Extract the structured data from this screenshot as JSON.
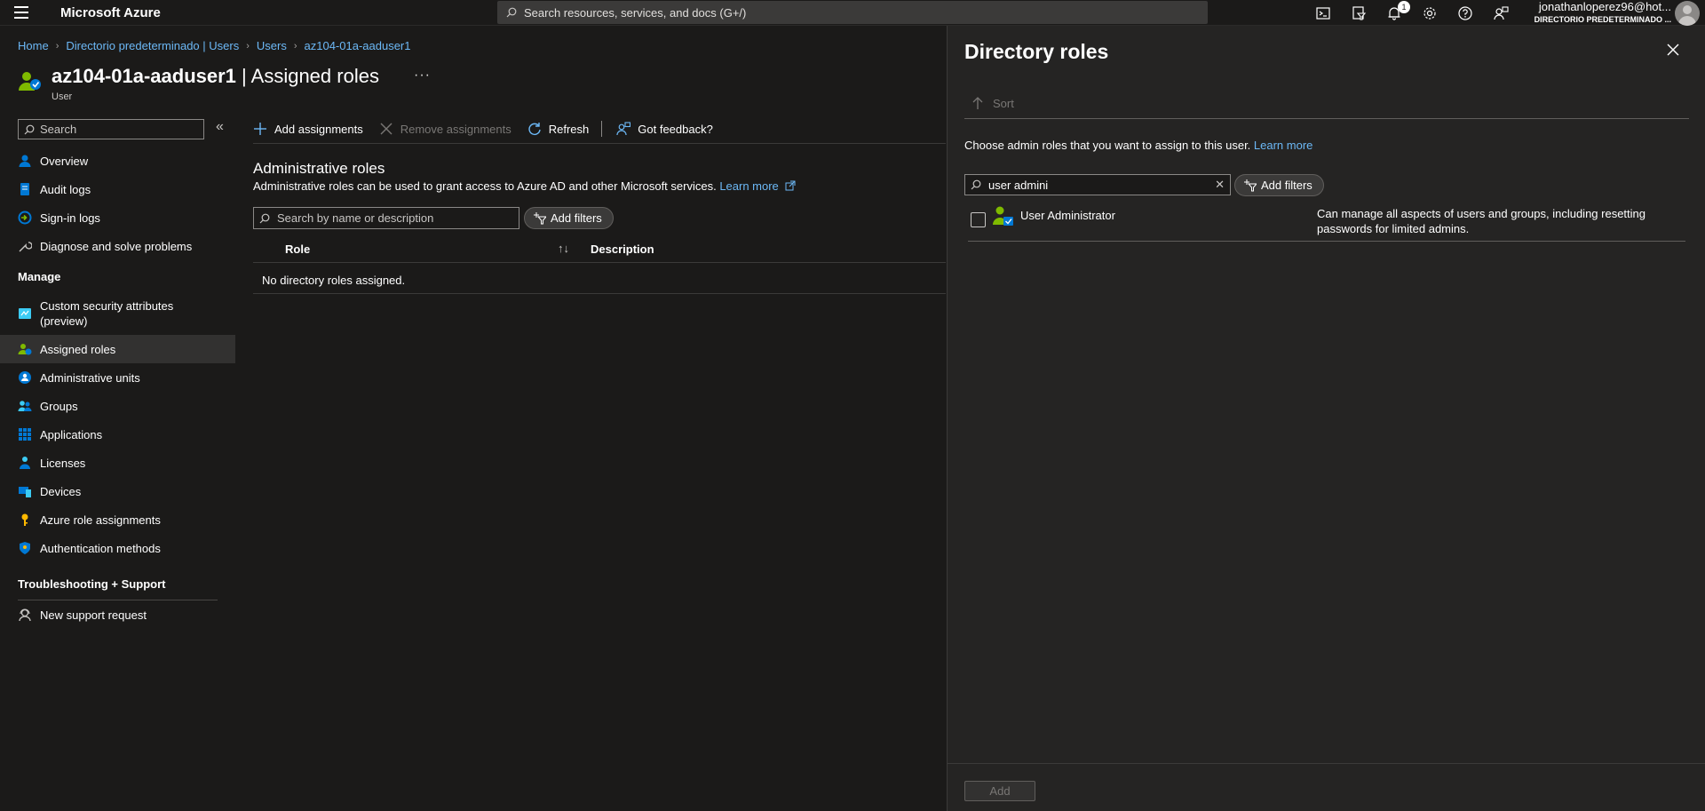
{
  "topbar": {
    "brand": "Microsoft Azure",
    "search_placeholder": "Search resources, services, and docs (G+/)",
    "notification_count": "1",
    "account_email": "jonathanlopere\u0007z96@hot...",
    "account_directory": "DIRECTORIO PREDETERMINADO ..."
  },
  "breadcrumb": [
    "Home",
    "Directorio predeterminado | Users",
    "Users",
    "az104-01a-aaduser1"
  ],
  "header": {
    "title_name": "az104-01a-aaduser1",
    "title_rest": " | Assigned roles",
    "more": "···",
    "subtitle": "User"
  },
  "nav": {
    "search_placeholder": "Search",
    "collapse": "«",
    "items_top": [
      {
        "label": "Overview",
        "icon": "user-icon"
      },
      {
        "label": "Audit logs",
        "icon": "audit-log-icon"
      },
      {
        "label": "Sign-in logs",
        "icon": "sign-in-icon"
      },
      {
        "label": "Diagnose and solve problems",
        "icon": "wrench-icon"
      }
    ],
    "manage_heading": "Manage",
    "items_manage": [
      {
        "label": "Custom security attributes (preview)",
        "icon": "security-attributes-icon"
      },
      {
        "label": "Assigned roles",
        "icon": "assigned-roles-icon"
      },
      {
        "label": "Administrative units",
        "icon": "admin-units-icon"
      },
      {
        "label": "Groups",
        "icon": "groups-icon"
      },
      {
        "label": "Applications",
        "icon": "applications-icon"
      },
      {
        "label": "Licenses",
        "icon": "licenses-icon"
      },
      {
        "label": "Devices",
        "icon": "devices-icon"
      },
      {
        "label": "Azure role assignments",
        "icon": "key-icon"
      },
      {
        "label": "Authentication methods",
        "icon": "shield-icon"
      }
    ],
    "support_heading": "Troubleshooting + Support",
    "items_support": [
      {
        "label": "New support request",
        "icon": "support-icon"
      }
    ]
  },
  "toolbar": {
    "add": "Add assignments",
    "remove": "Remove assignments",
    "refresh": "Refresh",
    "feedback": "Got feedback?"
  },
  "main": {
    "section_title": "Administrative roles",
    "section_desc": "Administrative roles can be used to grant access to Azure AD and other Microsoft services. ",
    "learn_more": "Learn more",
    "search_placeholder": "Search by name or description",
    "add_filters": "Add filters",
    "col_role": "Role",
    "col_sort": "↑↓",
    "col_desc": "Description",
    "empty_text": "No directory roles assigned."
  },
  "panel": {
    "title": "Directory roles",
    "sort": "Sort",
    "desc": "Choose admin roles that you want to assign to this user. ",
    "learn_more": "Learn more",
    "search_value": "user admini",
    "clear": "✕",
    "add_filters": "Add filters",
    "role_name": "User Administrator",
    "role_desc": "Can manage all aspects of users and groups, including resetting passwords for limited admins.",
    "add_button": "Add"
  }
}
